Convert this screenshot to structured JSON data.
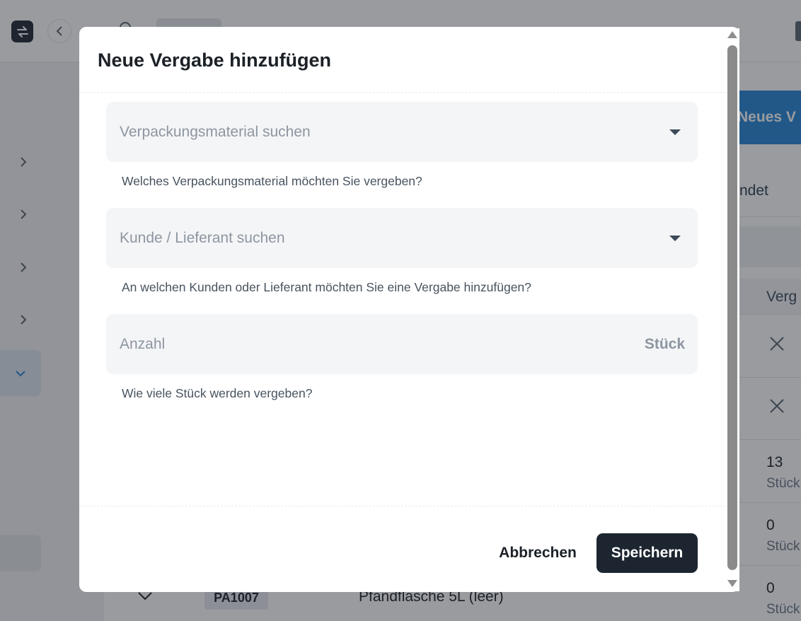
{
  "background": {
    "new_button_label": "Neues V",
    "tab_fragment": "ndet",
    "column_fragment": "Verg",
    "rows": [
      {
        "value": "13",
        "unit": "Stück"
      },
      {
        "value": "0",
        "unit": "Stück"
      },
      {
        "value": "0",
        "unit": "Stück"
      }
    ],
    "last_row": {
      "code": "PA1007",
      "name": "Pfandflasche 5L (leer)"
    }
  },
  "modal": {
    "title": "Neue Vergabe hinzufügen",
    "fields": {
      "material": {
        "placeholder": "Verpackungsmaterial suchen",
        "hint": "Welches Verpackungsmaterial möchten Sie vergeben?"
      },
      "partner": {
        "placeholder": "Kunde / Lieferant suchen",
        "hint": "An welchen Kunden oder Lieferant möchten Sie eine Vergabe hinzufügen?"
      },
      "quantity": {
        "placeholder": "Anzahl",
        "unit": "Stück",
        "hint": "Wie viele Stück werden vergeben?"
      }
    },
    "buttons": {
      "cancel": "Abbrechen",
      "save": "Speichern"
    }
  },
  "colors": {
    "primary_dark": "#1c2530",
    "accent_blue": "#2585d6",
    "field_bg": "#f4f5f7"
  }
}
